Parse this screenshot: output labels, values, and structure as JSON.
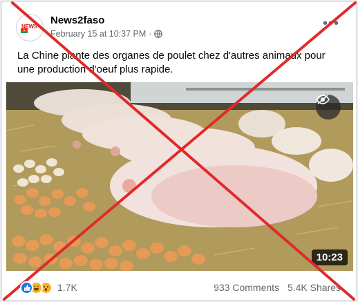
{
  "post": {
    "page_name": "News2faso",
    "avatar_text": "NEWS",
    "timestamp": "February 15 at 10:37 PM",
    "separator": "·",
    "more_glyph": "•••",
    "caption": "La Chine plante des organes de poulet chez d'autres animaux pour une production d'oeuf plus rapide.",
    "video": {
      "duration": "10:23"
    },
    "footer": {
      "reaction_count": "1.7K",
      "comments": "933 Comments",
      "shares": "5.4K Shares"
    }
  },
  "overlay": {
    "cross_color": "#e02a2a"
  }
}
